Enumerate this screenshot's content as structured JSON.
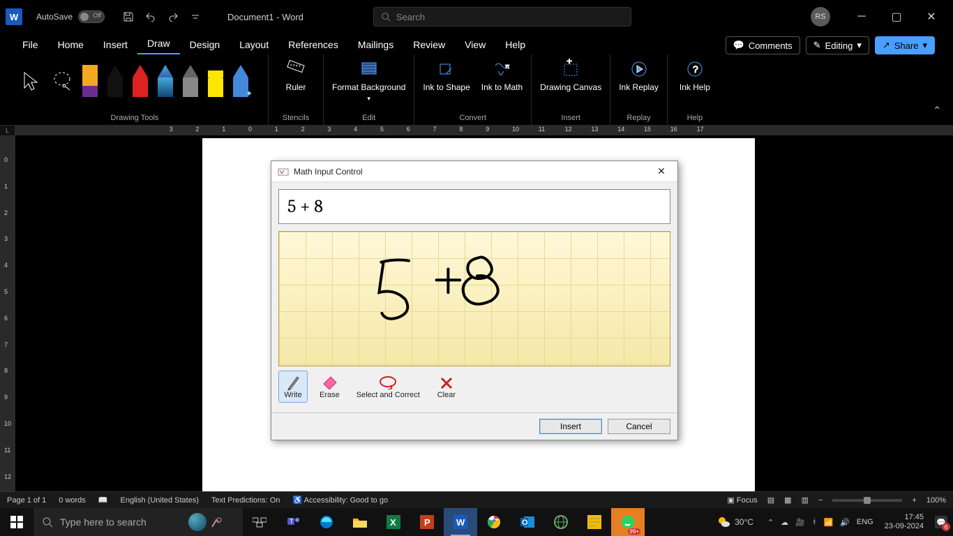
{
  "titlebar": {
    "autosave_label": "AutoSave",
    "autosave_state": "Off",
    "doc_title": "Document1  -  Word",
    "search_placeholder": "Search",
    "user_initials": "RS"
  },
  "tabs": {
    "file": "File",
    "home": "Home",
    "insert": "Insert",
    "draw": "Draw",
    "design": "Design",
    "layout": "Layout",
    "references": "References",
    "mailings": "Mailings",
    "review": "Review",
    "view": "View",
    "help": "Help",
    "comments": "Comments",
    "editing": "Editing",
    "share": "Share"
  },
  "ribbon": {
    "groups": {
      "drawing_tools": "Drawing Tools",
      "stencils": "Stencils",
      "edit": "Edit",
      "convert": "Convert",
      "insert": "Insert",
      "replay": "Replay",
      "help": "Help"
    },
    "ruler": "Ruler",
    "format_background": "Format Background",
    "ink_to_shape": "Ink to Shape",
    "ink_to_math": "Ink to Math",
    "drawing_canvas": "Drawing Canvas",
    "ink_replay": "Ink Replay",
    "ink_help": "Ink Help"
  },
  "dialog": {
    "title": "Math Input Control",
    "expression": "5 + 8",
    "tools": {
      "write": "Write",
      "erase": "Erase",
      "select_correct": "Select and Correct",
      "clear": "Clear"
    },
    "insert": "Insert",
    "cancel": "Cancel"
  },
  "statusbar": {
    "page": "Page 1 of 1",
    "words": "0 words",
    "language": "English (United States)",
    "text_predictions": "Text Predictions: On",
    "accessibility": "Accessibility: Good to go",
    "focus": "Focus",
    "zoom": "100%"
  },
  "taskbar": {
    "search_placeholder": "Type here to search",
    "weather_temp": "30°C",
    "lang": "ENG",
    "time": "17:45",
    "date": "23-09-2024",
    "notify_count": "6",
    "whatsapp_badge": "99+"
  }
}
